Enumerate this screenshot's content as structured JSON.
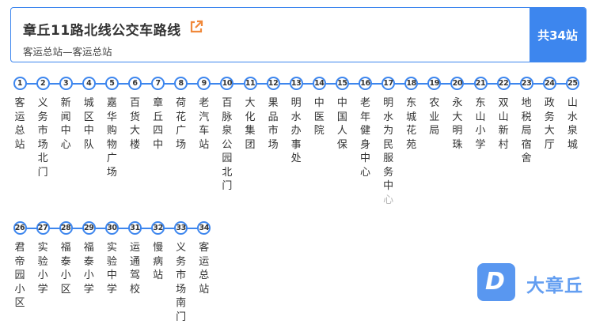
{
  "route": {
    "title": "章丘11路北线公交车路线",
    "terminals": "客运总站—客运总站",
    "stop_count_label": "共34站"
  },
  "icons": {
    "external_link": "external-link-icon",
    "watermark_logo": "dazhangqiu-logo-icon"
  },
  "colors": {
    "accent": "#3d86ee",
    "text": "#333333",
    "faded_text": "#b5b5b5"
  },
  "watermark": {
    "logo_letter": "D",
    "text": "大章丘"
  },
  "stops": [
    {
      "num": "1",
      "name": "客运总站"
    },
    {
      "num": "2",
      "name": "义务市场北门"
    },
    {
      "num": "3",
      "name": "新闻中心"
    },
    {
      "num": "4",
      "name": "城区中队"
    },
    {
      "num": "5",
      "name": "嘉华购物广场"
    },
    {
      "num": "6",
      "name": "百货大楼"
    },
    {
      "num": "7",
      "name": "章丘四中"
    },
    {
      "num": "8",
      "name": "荷花广场"
    },
    {
      "num": "9",
      "name": "老汽车站"
    },
    {
      "num": "10",
      "name": "百脉泉公园北门"
    },
    {
      "num": "11",
      "name": "大化集团"
    },
    {
      "num": "12",
      "name": "果品市场"
    },
    {
      "num": "13",
      "name": "明水办事处"
    },
    {
      "num": "14",
      "name": "中医院"
    },
    {
      "num": "15",
      "name": "中国人保"
    },
    {
      "num": "16",
      "name": "老年健身中心"
    },
    {
      "num": "17",
      "name": "明水为民服务中心"
    },
    {
      "num": "18",
      "name": "东城花苑"
    },
    {
      "num": "19",
      "name": "农业局"
    },
    {
      "num": "20",
      "name": "永大明珠"
    },
    {
      "num": "21",
      "name": "东山小学"
    },
    {
      "num": "22",
      "name": "双山新村"
    },
    {
      "num": "23",
      "name": "地税局宿舍"
    },
    {
      "num": "24",
      "name": "政务大厅"
    },
    {
      "num": "25",
      "name": "山水泉城"
    },
    {
      "num": "26",
      "name": "君帝园小区"
    },
    {
      "num": "27",
      "name": "实验小学"
    },
    {
      "num": "28",
      "name": "福泰小区"
    },
    {
      "num": "29",
      "name": "福泰小学"
    },
    {
      "num": "30",
      "name": "实验中学"
    },
    {
      "num": "31",
      "name": "运通驾校"
    },
    {
      "num": "32",
      "name": "慢病站"
    },
    {
      "num": "33",
      "name": "义务市场南门"
    },
    {
      "num": "34",
      "name": "客运总站"
    }
  ]
}
